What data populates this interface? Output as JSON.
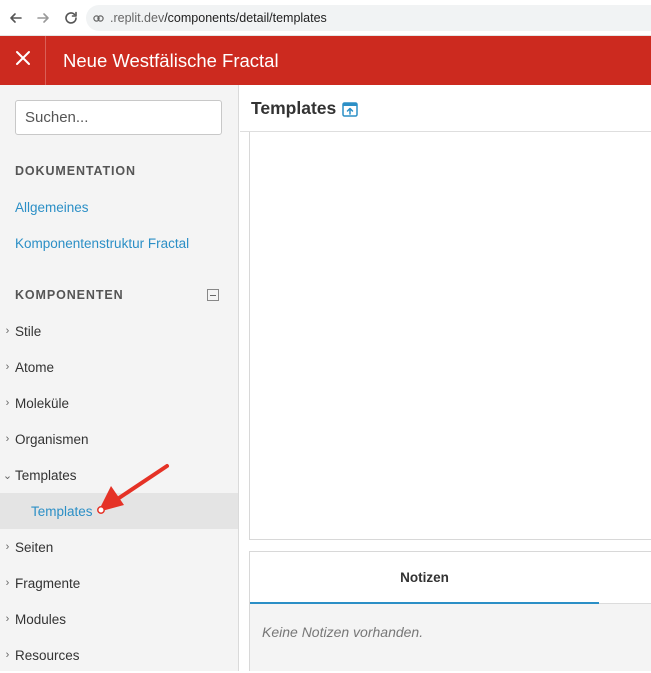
{
  "browser": {
    "url_host": ".replit.dev",
    "url_path": "/components/detail/templates",
    "icons": [
      "back-icon",
      "forward-icon",
      "reload-icon",
      "lock-icon"
    ]
  },
  "header": {
    "title": "Neue Westfälische Fractal",
    "background": "#cc2a1f"
  },
  "sidebar": {
    "search_placeholder": "Suchen...",
    "doc_heading": "DOKUMENTATION",
    "doc_links": [
      "Allgemeines",
      "Komponentenstruktur Fractal"
    ],
    "components_heading": "KOMPONENTEN",
    "tree": [
      {
        "label": "Stile",
        "expanded": false
      },
      {
        "label": "Atome",
        "expanded": false
      },
      {
        "label": "Moleküle",
        "expanded": false
      },
      {
        "label": "Organismen",
        "expanded": false
      },
      {
        "label": "Templates",
        "expanded": true
      },
      {
        "label": "Templates",
        "child": true,
        "active": true
      },
      {
        "label": "Seiten",
        "expanded": false
      },
      {
        "label": "Fragmente",
        "expanded": false
      },
      {
        "label": "Modules",
        "expanded": false
      },
      {
        "label": "Resources",
        "expanded": false
      }
    ],
    "link_color": "#2b8fc6"
  },
  "main": {
    "title": "Templates",
    "notes_tab": "Notizen",
    "notes_empty": "Keine Notizen vorhanden."
  }
}
